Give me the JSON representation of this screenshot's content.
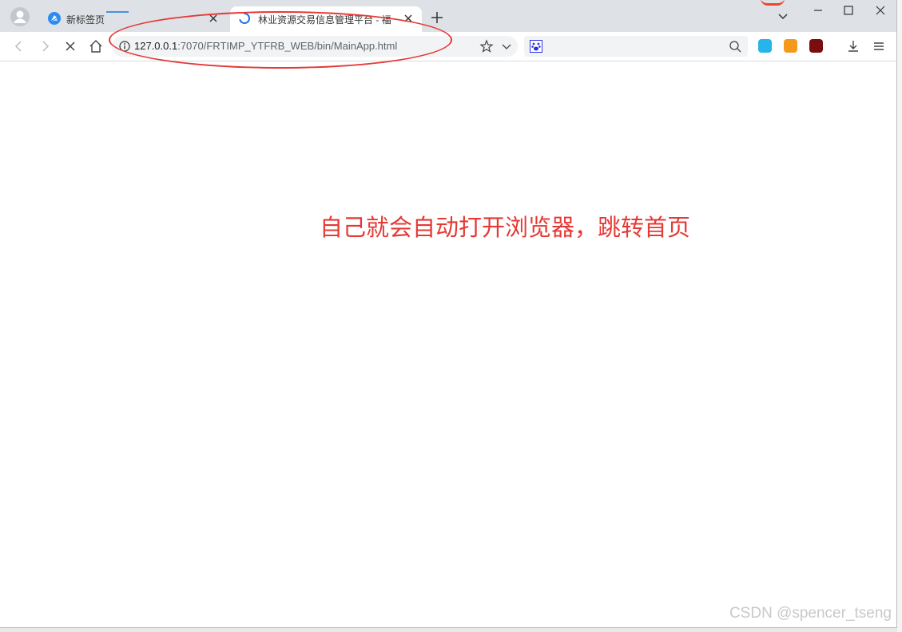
{
  "tabs": [
    {
      "title": "新标签页",
      "active": false
    },
    {
      "title": "林业资源交易信息管理平台 - 福",
      "active": true,
      "loading": true
    }
  ],
  "address": {
    "host": "127.0.0.1",
    "rest": ":7070/FRTIMP_YTFRB_WEB/bin/MainApp.html"
  },
  "annotation": "自己就会自动打开浏览器，跳转首页",
  "watermark": "CSDN @spencer_tseng",
  "colors": {
    "annotation": "#e53935",
    "tabstrip": "#dee1e6",
    "accent": "#4a90e2"
  },
  "icons": [
    "profile-icon",
    "browser-logo-icon",
    "loading-spinner-icon",
    "close-icon",
    "new-tab-icon",
    "dropdown-icon",
    "minimize-icon",
    "maximize-icon",
    "close-window-icon",
    "back-icon",
    "forward-icon",
    "stop-icon",
    "home-icon",
    "info-icon",
    "star-icon",
    "chevron-down-icon",
    "paw-icon",
    "search-icon",
    "download-icon",
    "menu-icon"
  ]
}
